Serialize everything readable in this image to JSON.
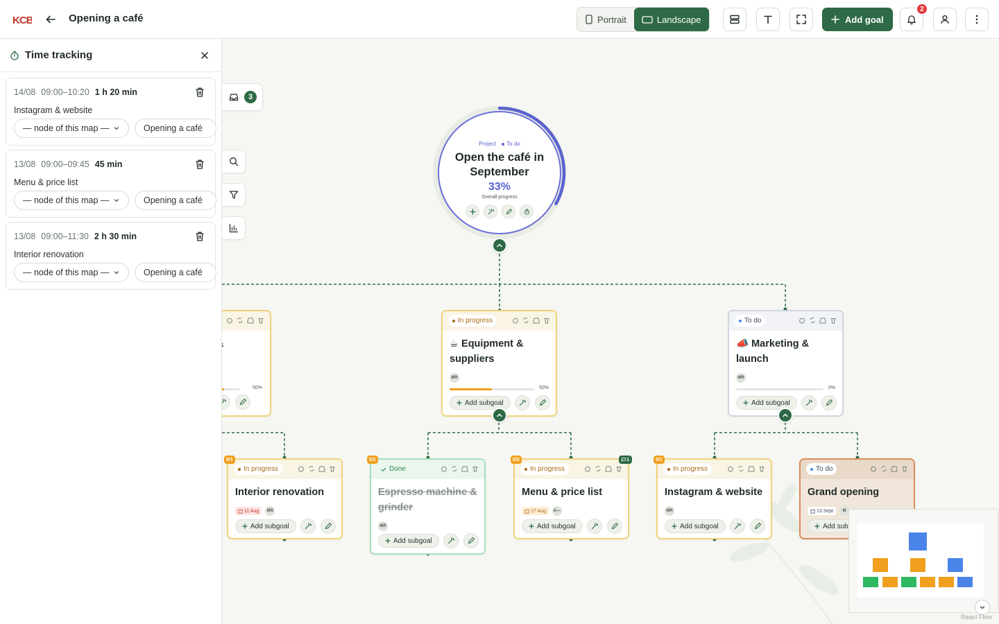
{
  "app": {
    "logo_text": "KCB",
    "map_title": "Opening a café"
  },
  "toolbar": {
    "portrait_label": "Portrait",
    "landscape_label": "Landscape",
    "active_orientation": "Landscape",
    "add_goal_label": "Add goal",
    "notification_count": "2",
    "accent": "#2d6a45"
  },
  "time_panel": {
    "title": "Time tracking",
    "entries": [
      {
        "date": "14/08",
        "time": "09:00–10:20",
        "duration": "1 h 20 min",
        "description": "Instagram & website",
        "node_select": "— node of this map —",
        "map_select": "Opening a café"
      },
      {
        "date": "13/08",
        "time": "09:00–09:45",
        "duration": "45 min",
        "description": "Menu & price list",
        "node_select": "— node of this map —",
        "map_select": "Opening a café"
      },
      {
        "date": "13/08",
        "time": "09:00–11:30",
        "duration": "2 h 30 min",
        "description": "Interior renovation",
        "node_select": "— node of this map —",
        "map_select": "Opening a café"
      }
    ]
  },
  "canvas": {
    "inbox_count": "3",
    "root": {
      "tag_project": "Project",
      "tag_status": "To do",
      "title": "Open the café in September",
      "progress": "33%",
      "progress_value": 0.33,
      "progress_label": "Overall progress"
    },
    "goals": [
      {
        "id": "partial",
        "status": "",
        "title": "&",
        "progress": "50%",
        "progress_value": 0.5
      },
      {
        "id": "equipment",
        "status": "In progress",
        "emoji": "☕",
        "title": "Equipment & suppliers",
        "avatar": "MR",
        "progress": "50%",
        "progress_value": 0.5,
        "add_label": "Add subgoal"
      },
      {
        "id": "marketing",
        "status": "To do",
        "emoji": "📣",
        "title": "Marketing & launch",
        "avatar": "MR",
        "progress": "0%",
        "progress_value": 0,
        "add_label": "Add subgoal"
      }
    ],
    "subgoals": [
      {
        "id": "interior",
        "badge": "0/1",
        "status": "In progress",
        "title": "Interior renovation",
        "date": "11 Aug",
        "avatar": "MR",
        "add_label": "Add subgoal"
      },
      {
        "id": "espresso",
        "badge": "0/1",
        "status": "Done",
        "title": "Espresso machine & grinder",
        "avatar": "MR",
        "add_label": "Add subgoal"
      },
      {
        "id": "menu",
        "badge": "0/2",
        "status": "In progress",
        "title": "Menu & price list",
        "date": "17 Aug",
        "avatar": "A—",
        "comments": "1",
        "add_label": "Add subgoal"
      },
      {
        "id": "instagram",
        "badge": "0/1",
        "status": "In progress",
        "title": "Instagram & website",
        "avatar": "MR",
        "add_label": "Add subgoal"
      },
      {
        "id": "grand",
        "status": "To do",
        "title": "Grand opening",
        "date": "13 Sept",
        "avatar": "M",
        "add_label": "Add sub"
      }
    ],
    "attribution": "React Flow"
  },
  "colors": {
    "in_progress": "#f0a01e",
    "todo": "#4a84e8",
    "done": "#2fb862",
    "root_ring": "#5b63cf"
  }
}
